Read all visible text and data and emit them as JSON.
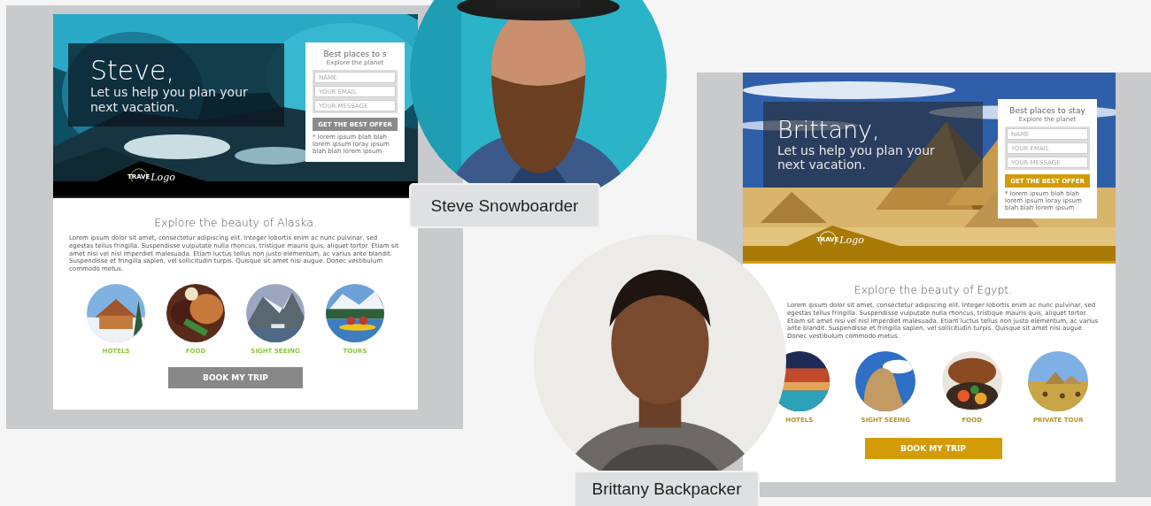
{
  "cards": [
    {
      "kind": "alaska",
      "hero": {
        "greeting": "Steve,",
        "tagline": "Let us help you plan your next vacation."
      },
      "form": {
        "title": "Best places to s",
        "subtitle": "Explore the planet",
        "fields": [
          {
            "placeholder": "NAME"
          },
          {
            "placeholder": "YOUR EMAIL"
          },
          {
            "placeholder": "YOUR MESSAGE"
          }
        ],
        "button": "GET THE BEST OFFER",
        "note": "* lorem ipsum blah blah lorem ipsum loray ipsum blah blah lorem ipsum"
      },
      "logo": {
        "small": "TRAVE",
        "script": "Logo"
      },
      "heading": "Explore the beauty of Alaska.",
      "paragraph": "Lorem ipsum dolor sit amet, consectetur adipiscing elit. Integer lobortis enim ac nunc pulvinar, sed egestas tellus fringilla. Suspendisse vulputate nulla rhoncus, tristique mauris quis, aliquet tortor. Etiam sit amet nisi vel nisl imperdiet malesuada. Etiam luctus tellus non justo elementum, ac varius ante blandit. Suspendisse et fringilla sapien, vel sollicitudin turpis. Quisque sit amet nisi augue. Donec vestibulum commodo metus.",
      "categories": [
        {
          "label": "HOTELS"
        },
        {
          "label": "FOOD"
        },
        {
          "label": "SIGHT SEEING"
        },
        {
          "label": "TOURS"
        }
      ],
      "cta": "BOOK MY TRIP",
      "persona": {
        "name": "Steve Snowboarder"
      }
    },
    {
      "kind": "egypt",
      "hero": {
        "greeting": "Brittany,",
        "tagline": "Let us help you plan your next vacation."
      },
      "form": {
        "title": "Best places to stay",
        "subtitle": "Explore the planet",
        "fields": [
          {
            "placeholder": "NAME"
          },
          {
            "placeholder": "YOUR EMAIL"
          },
          {
            "placeholder": "YOUR MESSAGE"
          }
        ],
        "button": "GET THE BEST OFFER",
        "note": "* lorem ipsum blah blah lorem ipsum loray ipsum blah blah lorem ipsum"
      },
      "logo": {
        "small": "TRAVE",
        "script": "Logo"
      },
      "heading": "Explore the beauty of Egypt.",
      "paragraph": "Lorem ipsum dolor sit amet, consectetur adipiscing elit. Integer lobortis enim ac nunc pulvinar, sed egestas tellus fringilla. Suspendisse vulputate nulla rhoncus, tristique mauris quis, aliquet tortor. Etiam sit amet nisi vel nisl imperdiet malesuada. Etiam luctus tellus non justo elementum, ac varius ante blandit. Suspendisse et fringilla sapien, vel sollicitudin turpis. Quisque sit amet nisi augue. Donec vestibulum commodo metus.",
      "categories": [
        {
          "label": "HOTELS"
        },
        {
          "label": "SIGHT SEEING"
        },
        {
          "label": "FOOD"
        },
        {
          "label": "PRIVATE TOUR"
        }
      ],
      "cta": "BOOK MY TRIP",
      "persona": {
        "name": "Brittany Backpacker"
      }
    }
  ]
}
